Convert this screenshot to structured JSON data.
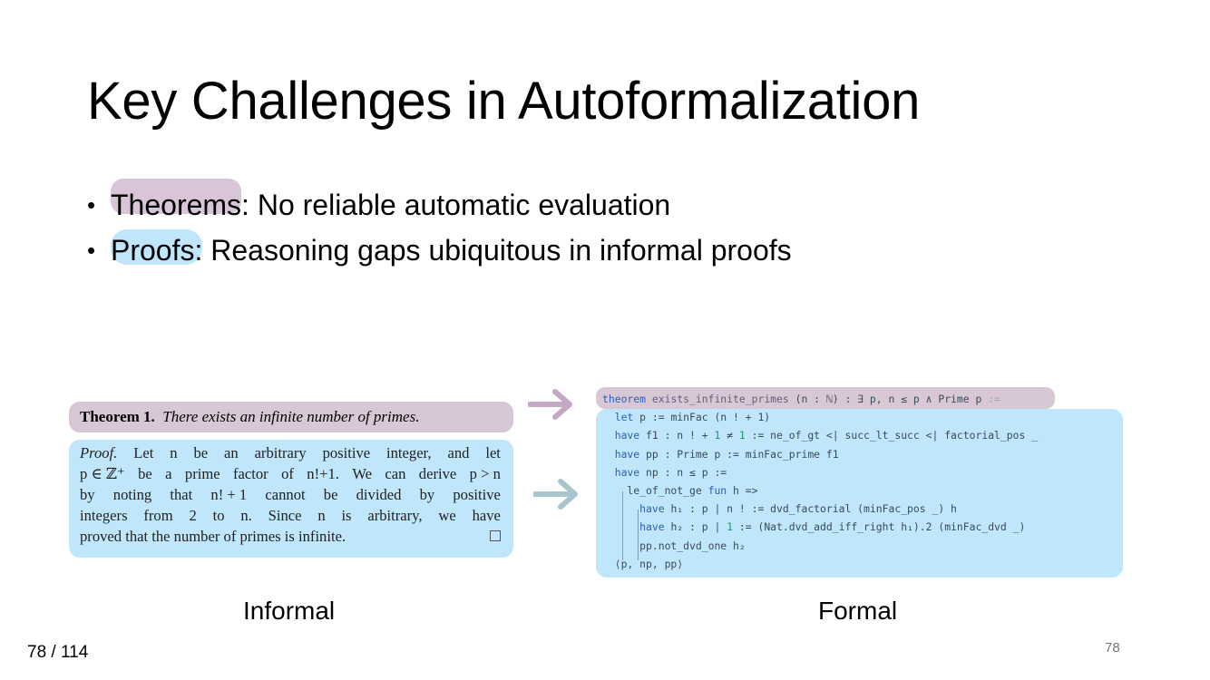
{
  "title": "Key Challenges in Autoformalization",
  "bullets": [
    {
      "label": "Theorems",
      "text": ": No reliable automatic evaluation"
    },
    {
      "label": "Proofs:",
      "text": " Reasoning gaps ubiquitous in informal proofs"
    }
  ],
  "informal": {
    "theorem_label": "Theorem 1.",
    "theorem_text": "There exists an infinite number of primes.",
    "proof_lines": [
      [
        "Proof.",
        "Let",
        "n",
        "be",
        "an",
        "arbitrary",
        "positive",
        "integer,",
        "and",
        "let"
      ],
      [
        "p ∈ ℤ⁺",
        "be",
        "a",
        "prime",
        "factor",
        "of",
        "n!+1.",
        "We",
        "can",
        "derive",
        "p > n"
      ],
      [
        "by",
        "noting",
        "that",
        "n! + 1",
        "cannot",
        "be",
        "divided",
        "by",
        "positive"
      ],
      [
        "integers",
        "from",
        "2",
        "to",
        "n.",
        "Since",
        "n",
        "is",
        "arbitrary,",
        "we",
        "have"
      ],
      [
        "proved that the number of primes is infinite."
      ]
    ]
  },
  "formal": {
    "lines": [
      "theorem exists_infinite_primes (n : ℕ) : ∃ p, n ≤ p ∧ Prime p :=",
      "  let p := minFac (n ! + 1)",
      "  have f1 : n ! + 1 ≠ 1 := ne_of_gt <| succ_lt_succ <| factorial_pos _",
      "  have pp : Prime p := minFac_prime f1",
      "  have np : n ≤ p :=",
      "    le_of_not_ge fun h =>",
      "      have h₁ : p ∣ n ! := dvd_factorial (minFac_pos _) h",
      "      have h₂ : p ∣ 1 := (Nat.dvd_add_iff_right h₁).2 (minFac_dvd _)",
      "      pp.not_dvd_one h₂",
      "  ⟨p, np, pp⟩"
    ]
  },
  "captions": {
    "informal": "Informal",
    "formal": "Formal"
  },
  "footer": {
    "page_counter": "78 / 114",
    "slide_number": "78"
  },
  "colors": {
    "theorem_highlight": "#d8c5d8",
    "proof_highlight": "#bfe6fa",
    "arrow_top": "#c4a8c4",
    "arrow_bottom": "#a8c4cc"
  }
}
